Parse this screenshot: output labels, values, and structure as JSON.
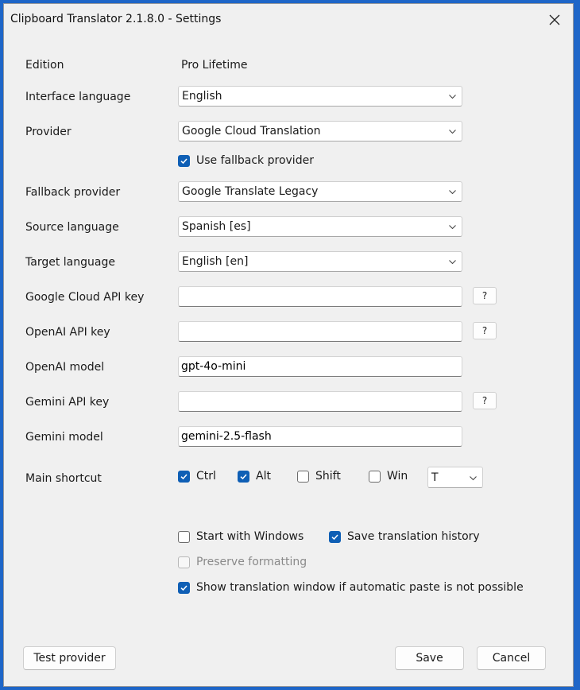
{
  "window": {
    "title": "Clipboard Translator 2.1.8.0 - Settings"
  },
  "edition": {
    "label": "Edition",
    "value": "Pro Lifetime"
  },
  "interface_language": {
    "label": "Interface language",
    "value": "English"
  },
  "provider": {
    "label": "Provider",
    "value": "Google Cloud Translation"
  },
  "use_fallback": {
    "label": "Use fallback provider",
    "checked": true
  },
  "fallback_provider": {
    "label": "Fallback provider",
    "value": "Google Translate Legacy"
  },
  "source_language": {
    "label": "Source language",
    "value": "Spanish [es]"
  },
  "target_language": {
    "label": "Target language",
    "value": "English [en]"
  },
  "google_cloud_api_key": {
    "label": "Google Cloud API key",
    "value": "",
    "help": "?"
  },
  "openai_api_key": {
    "label": "OpenAI API key",
    "value": "",
    "help": "?"
  },
  "openai_model": {
    "label": "OpenAI model",
    "value": "gpt-4o-mini"
  },
  "gemini_api_key": {
    "label": "Gemini API key",
    "value": "",
    "help": "?"
  },
  "gemini_model": {
    "label": "Gemini model",
    "value": "gemini-2.5-flash"
  },
  "main_shortcut": {
    "label": "Main shortcut",
    "ctrl": {
      "label": "Ctrl",
      "checked": true
    },
    "alt": {
      "label": "Alt",
      "checked": true
    },
    "shift": {
      "label": "Shift",
      "checked": false
    },
    "win": {
      "label": "Win",
      "checked": false
    },
    "key": "T"
  },
  "options": {
    "start_with_windows": {
      "label": "Start with Windows",
      "checked": false
    },
    "save_history": {
      "label": "Save translation history",
      "checked": true
    },
    "preserve_formatting": {
      "label": "Preserve formatting",
      "checked": false,
      "disabled": true
    },
    "show_window": {
      "label": "Show translation window if automatic paste is not possible",
      "checked": true
    }
  },
  "buttons": {
    "test_provider": "Test provider",
    "save": "Save",
    "cancel": "Cancel"
  },
  "colors": {
    "accent": "#0f5fb5",
    "window_bg": "#f0f0f0",
    "desktop_bg": "#1e66c8"
  }
}
